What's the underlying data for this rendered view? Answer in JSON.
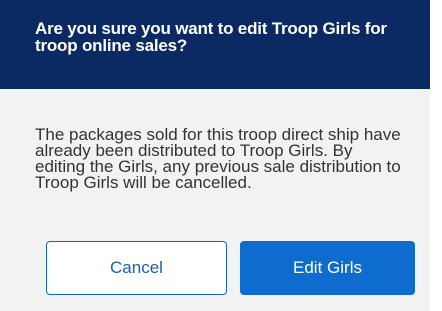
{
  "dialog": {
    "title": "Are you sure you want to edit Troop Girls for troop online sales?",
    "message": "The packages sold for this troop direct ship have already been distributed to Troop Girls. By editing the Girls, any previous sale distribution to Troop Girls will be cancelled.",
    "cancel_label": "Cancel",
    "confirm_label": "Edit Girls"
  },
  "colors": {
    "header_background": "#0b2a63",
    "dialog_background": "#f2f2f2",
    "primary_button": "#0f6ccf",
    "secondary_button_border": "#1565c0"
  }
}
